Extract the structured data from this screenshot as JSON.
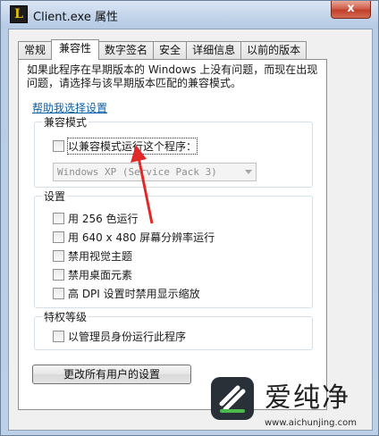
{
  "window": {
    "title": "Client.exe 属性",
    "icon_letter": "L",
    "close_label": "x"
  },
  "tabs": [
    {
      "label": "常规",
      "active": false
    },
    {
      "label": "兼容性",
      "active": true
    },
    {
      "label": "数字签名",
      "active": false
    },
    {
      "label": "安全",
      "active": false
    },
    {
      "label": "详细信息",
      "active": false
    },
    {
      "label": "以前的版本",
      "active": false
    }
  ],
  "compat": {
    "intro": "如果此程序在早期版本的 Windows 上没有问题，而现在出现问题，请选择与该早期版本匹配的兼容模式。",
    "help_link": "帮助我选择设置",
    "mode_group": {
      "label": "兼容模式",
      "checkbox_label": "以兼容模式运行这个程序：",
      "os_select_value": "Windows XP (Service Pack 3)"
    },
    "settings_group": {
      "label": "设置",
      "options": [
        "用 256 色运行",
        "用 640 x 480 屏幕分辨率运行",
        "禁用视觉主题",
        "禁用桌面元素",
        "高 DPI 设置时禁用显示缩放"
      ]
    },
    "privilege_group": {
      "label": "特权等级",
      "checkbox_label": "以管理员身份运行此程序"
    },
    "all_users_button": "更改所有用户的设置"
  },
  "watermark": {
    "text": "爱纯净",
    "url": "www.aichunjing.com"
  },
  "colors": {
    "annotation_arrow": "#e02a2a",
    "link": "#0b5fa8"
  }
}
